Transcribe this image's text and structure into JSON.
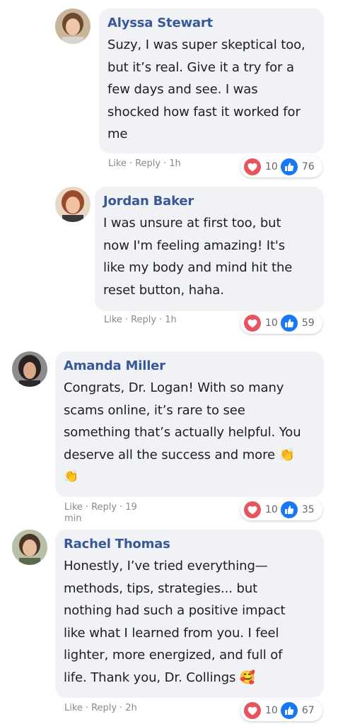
{
  "accent": {
    "name_color": "#385898",
    "love": "#e8545e",
    "like": "#1877f2",
    "bubble": "#f0f2f5"
  },
  "comments": [
    {
      "author": "Alyssa Stewart",
      "lines": [
        "Suzy, I was super skeptical too,",
        "but it’s real. Give it a try for a",
        "few days and see. I was",
        "shocked how fast it worked for",
        "me"
      ],
      "actions": {
        "like": "Like",
        "reply": "Reply",
        "time": "1h"
      },
      "reactions": {
        "love_icon": "heart-icon",
        "love_count": "10",
        "like_icon": "thumbs-up-icon",
        "like_count": "76"
      }
    },
    {
      "author": "Jordan Baker",
      "lines": [
        "I was unsure at first too, but",
        "now I'm feeling amazing! It's",
        "like my body and mind hit the",
        "reset button, haha."
      ],
      "actions": {
        "like": "Like",
        "reply": "Reply",
        "time": "1h"
      },
      "reactions": {
        "love_icon": "heart-icon",
        "love_count": "10",
        "like_icon": "thumbs-up-icon",
        "like_count": "59"
      }
    },
    {
      "author": "Amanda Miller",
      "lines": [
        "Congrats, Dr. Logan! With so many",
        "scams online, it’s rare to see",
        "something that’s actually helpful. You",
        "deserve all the success and more 👏",
        "👏"
      ],
      "actions": {
        "like": "Like",
        "reply": "Reply",
        "time": "19 min"
      },
      "reactions": {
        "love_icon": "heart-icon",
        "love_count": "10",
        "like_icon": "thumbs-up-icon",
        "like_count": "35"
      }
    },
    {
      "author": "Rachel Thomas",
      "lines": [
        "Honestly, I’ve tried everything—",
        "methods, tips, strategies... but",
        "nothing had such a positive impact",
        "like what I learned from you. I feel",
        "lighter, more energized, and full of",
        "life. Thank you, Dr. Collings 🥰"
      ],
      "actions": {
        "like": "Like",
        "reply": "Reply",
        "time": "2h"
      },
      "reactions": {
        "love_icon": "heart-icon",
        "love_count": "10",
        "like_icon": "thumbs-up-icon",
        "like_count": "67"
      }
    }
  ]
}
